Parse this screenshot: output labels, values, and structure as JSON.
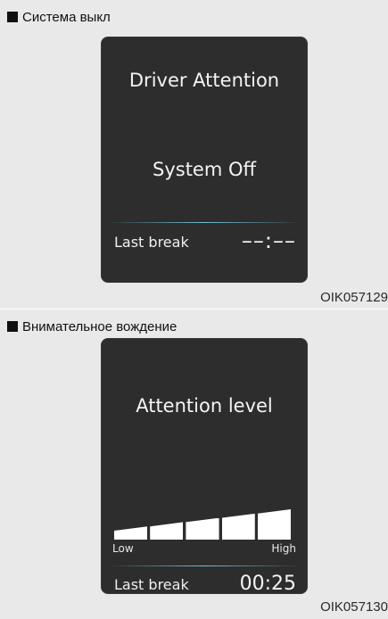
{
  "panel1": {
    "caption": "Система выкл",
    "screen": {
      "title": "Driver Attention",
      "status": "System Off",
      "last_break_label": "Last break",
      "last_break_value": "––:––"
    },
    "figure_code": "OIK057129"
  },
  "panel2": {
    "caption": "Внимательное вождение",
    "screen": {
      "title": "Attention level",
      "low_label": "Low",
      "high_label": "High",
      "level_segments": 5,
      "level_filled": 5,
      "last_break_label": "Last break",
      "last_break_value": "00:25"
    },
    "figure_code": "OIK057130"
  },
  "colors": {
    "screen_background": "#2d2d2d",
    "screen_text": "#f4f4f4",
    "accent_line": "#6fc0d2",
    "page_background": "#e9e9e9"
  }
}
